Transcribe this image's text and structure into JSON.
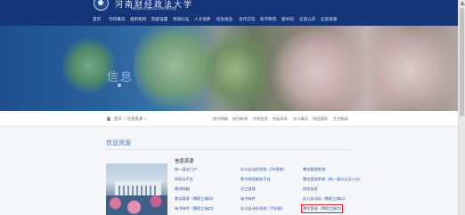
{
  "header": {
    "school_name_cn": "河南财经政法大学",
    "school_name_en": "Henan Finance University",
    "nav": [
      "首页",
      "学校概况",
      "组织机构",
      "院部设置",
      "师资队伍",
      "人才培养",
      "招生就业",
      "合作交流",
      "科学研究",
      "图书馆",
      "信息公开",
      "信息资源"
    ]
  },
  "banner": {
    "caption": "信息"
  },
  "breadcrumb": {
    "home": "首页",
    "current": "信息资源",
    "sep": ">"
  },
  "quick_links": [
    "校内邮箱",
    "校内新闻",
    "学校信息",
    "校友风采",
    "办公电话",
    "校园通网",
    "生活服务"
  ],
  "section": {
    "title": "信息资源"
  },
  "list": {
    "title": "信息资源",
    "col1": [
      "统一身份门户",
      "科研云平台",
      "教师邮箱",
      "教务管理（教职工端口）",
      "电子邮件（教职工端口）"
    ],
    "col2": [
      "办公自动化系统（OA系统）",
      "数字校园服务平台",
      "学工管理",
      "电子邮件",
      "办公自动化系统（手机版）"
    ],
    "col3": [
      "教务管理系统",
      "教务管理系统（统一身份认证入口）",
      "财务信息",
      "办公自动化（教职工端口）",
      "教学管理（教职工端口）"
    ]
  },
  "colors": {
    "header_bg": "#16367a",
    "link": "#2d58a4",
    "highlight": "#e02424"
  }
}
